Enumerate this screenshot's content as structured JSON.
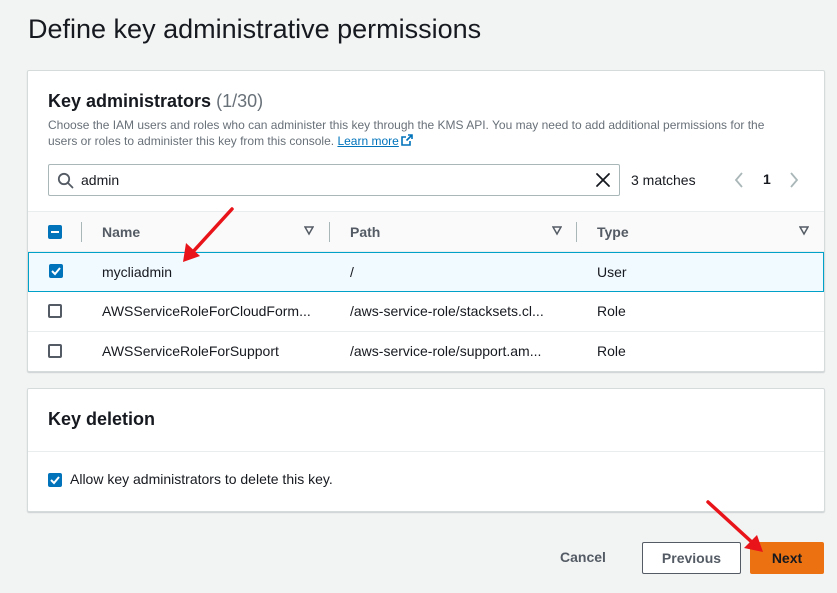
{
  "page": {
    "title": "Define key administrative permissions"
  },
  "key_admins": {
    "heading": "Key administrators",
    "count": "(1/30)",
    "description": "Choose the IAM users and roles who can administer this key through the KMS API. You may need to add additional permissions for the users or roles to administer this key from this console.",
    "learn_more": "Learn more",
    "search": {
      "value": "admin",
      "placeholder": ""
    },
    "matches": "3 matches",
    "pagination": {
      "current_page": "1"
    },
    "columns": {
      "name": "Name",
      "path": "Path",
      "type": "Type"
    },
    "rows": [
      {
        "name": "mycliadmin",
        "path": "/",
        "type": "User",
        "checked": true
      },
      {
        "name": "AWSServiceRoleForCloudForm...",
        "path": "/aws-service-role/stacksets.cl...",
        "type": "Role",
        "checked": false
      },
      {
        "name": "AWSServiceRoleForSupport",
        "path": "/aws-service-role/support.am...",
        "type": "Role",
        "checked": false
      }
    ]
  },
  "key_deletion": {
    "heading": "Key deletion",
    "checkbox_label": "Allow key administrators to delete this key.",
    "checked": true
  },
  "footer": {
    "cancel_label": "Cancel",
    "previous_label": "Previous",
    "next_label": "Next"
  },
  "colors": {
    "primary_button": "#ec7211",
    "link": "#0073bb",
    "checkbox": "#0073bb",
    "annotation_arrow": "#e8141a"
  },
  "icons": [
    "search-icon",
    "clear-icon",
    "external-link-icon",
    "chevron-left-icon",
    "chevron-right-icon",
    "sort-icon",
    "check-icon"
  ]
}
